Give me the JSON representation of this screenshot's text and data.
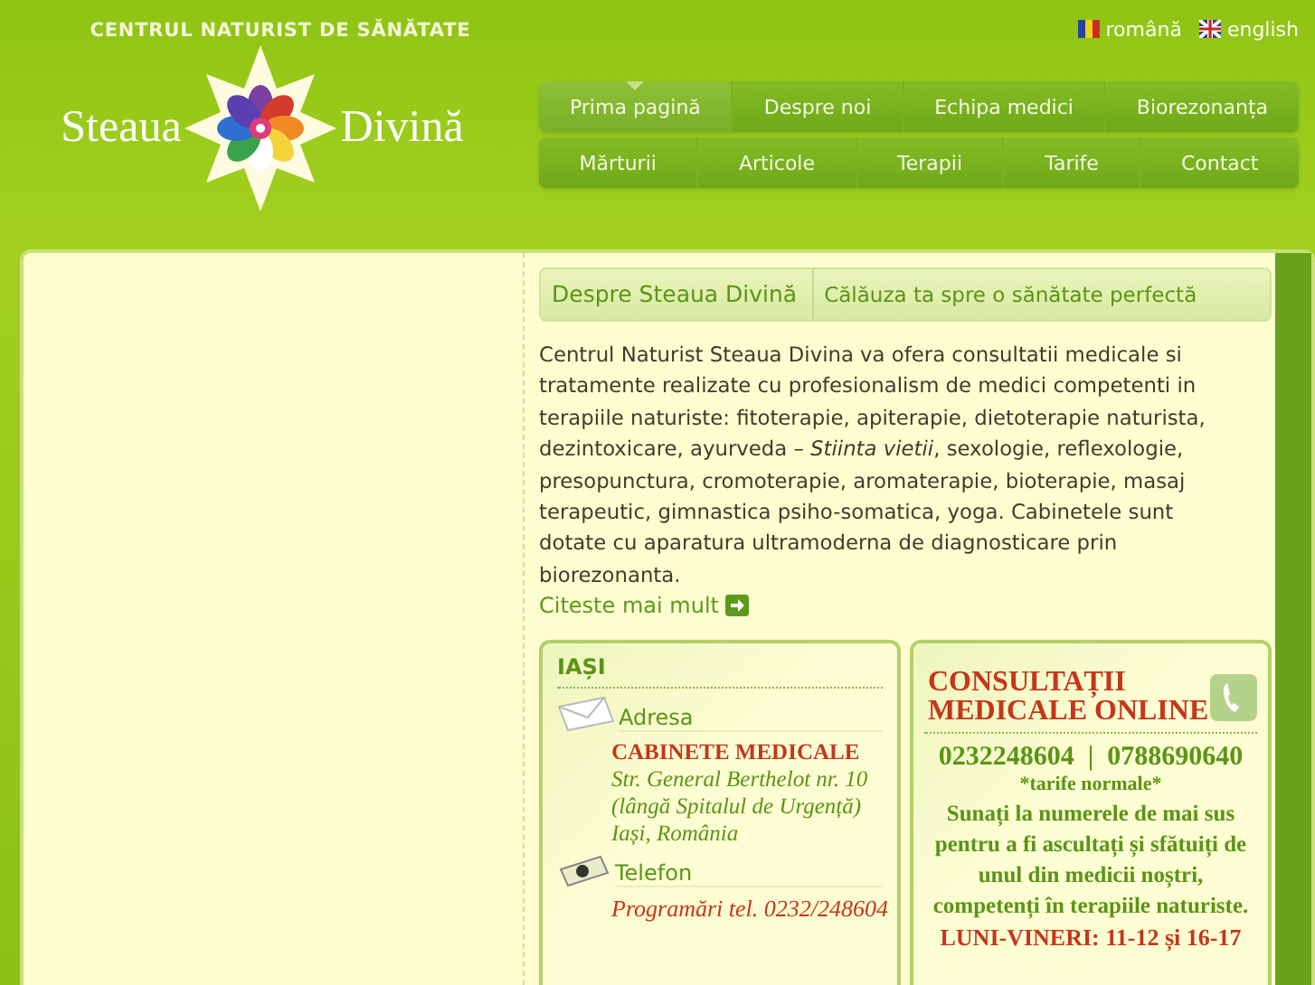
{
  "header": {
    "tagline": "CENTRUL NATURIST DE SĂNĂTATE",
    "logo_left": "Steaua",
    "logo_right": "Divină",
    "languages": [
      {
        "label": "română"
      },
      {
        "label": "english"
      }
    ]
  },
  "nav": [
    [
      {
        "label": "Prima pagină",
        "selected": true
      },
      {
        "label": "Despre noi",
        "selected": false
      },
      {
        "label": "Echipa medici",
        "selected": false
      },
      {
        "label": "Biorezonanța",
        "selected": false
      }
    ],
    [
      {
        "label": "Mărturii",
        "selected": false
      },
      {
        "label": "Articole",
        "selected": false
      },
      {
        "label": "Terapii",
        "selected": false
      },
      {
        "label": "Tarife",
        "selected": false
      },
      {
        "label": "Contact",
        "selected": false
      }
    ]
  ],
  "intro": {
    "title": "Despre Steaua Divină",
    "subtitle": "Călăuza ta spre o sănătate perfectă",
    "text": "Centrul Naturist Steaua Divina va ofera consultatii medicale si tratamente realizate cu profesionalism de medici competenti in terapiile naturiste: fitoterapie, apiterapie, dietoterapie naturista, dezintoxicare, ayurveda – *Stiinta vietii*, sexologie, reflexologie, presopunctura, cromoterapie, aromaterapie, bioterapie, masaj terapeutic, gimnastica psiho-somatica, yoga. Cabinetele sunt dotate cu aparatura ultramoderna de diagnosticare prin biorezonanta.",
    "more_link": "Citeste mai mult"
  },
  "location": {
    "city": "IAȘI",
    "address_label": "Adresa",
    "office": "CABINETE MEDICALE",
    "address_lines": [
      "Str. General Berthelot nr. 10",
      "(lângă Spitalul de Urgență)",
      "Iași, România"
    ],
    "phone_label": "Telefon",
    "phone": "Programări tel. 0232/248604"
  },
  "online": {
    "title_lines": [
      "CONSULTAȚII",
      "MEDICALE ONLINE"
    ],
    "phones": "0232248604  |  0788690640",
    "note": "*tarife normale*",
    "text": "Sunați la numerele de mai sus pentru a fi ascultați și sfătuiți de unul din medicii noștri, competenți în terapiile naturiste.",
    "hours": "LUNI-VINERI: 11-12 și 16-17"
  }
}
